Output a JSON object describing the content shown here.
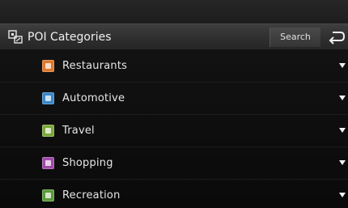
{
  "header": {
    "title": "POI Categories",
    "search_label": "Search",
    "poi_icon": "poi-categories-icon",
    "back_icon": "back-arrow-icon"
  },
  "categories": [
    {
      "label": "Restaurants",
      "icon": "restaurant-icon",
      "color": "#e0782c"
    },
    {
      "label": "Automotive",
      "icon": "car-icon",
      "color": "#3a86c8"
    },
    {
      "label": "Travel",
      "icon": "travel-icon",
      "color": "#7aa83a"
    },
    {
      "label": "Shopping",
      "icon": "shopping-icon",
      "color": "#a04aa8"
    },
    {
      "label": "Recreation",
      "icon": "recreation-icon",
      "color": "#5a9a3a"
    }
  ]
}
